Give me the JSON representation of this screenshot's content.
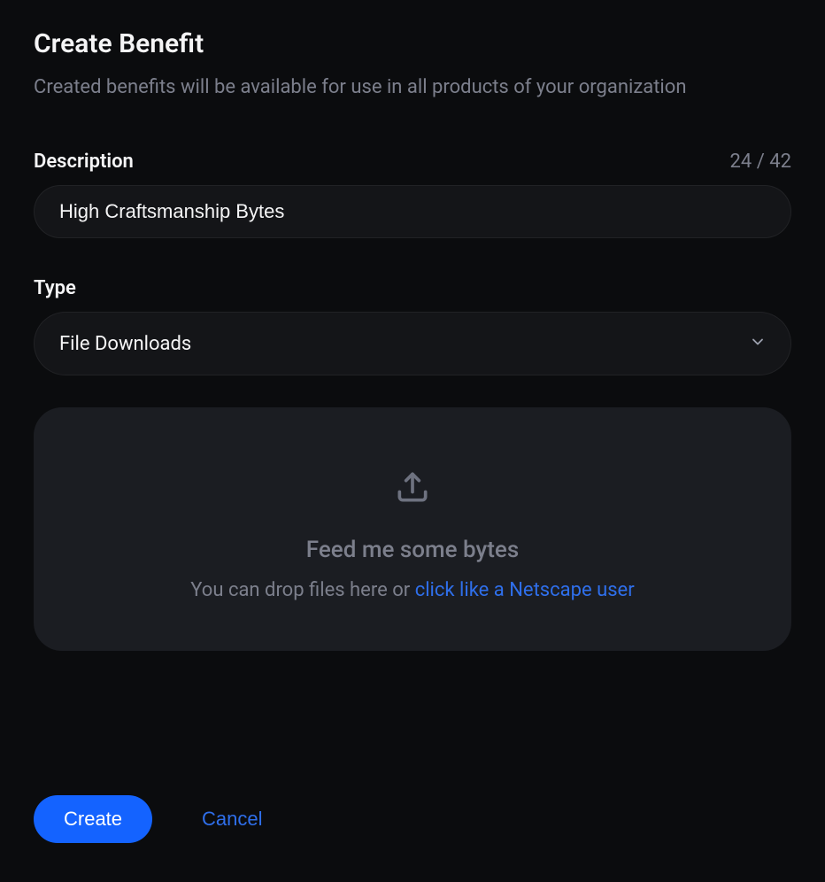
{
  "header": {
    "title": "Create Benefit",
    "subtitle": "Created benefits will be available for use in all products of your organization"
  },
  "form": {
    "description_label": "Description",
    "description_counter": "24 / 42",
    "description_value": "High Craftsmanship Bytes",
    "type_label": "Type",
    "type_value": "File Downloads"
  },
  "dropzone": {
    "title": "Feed me some bytes",
    "subtitle_prefix": "You can drop files here or ",
    "subtitle_link": "click like a Netscape user"
  },
  "actions": {
    "create": "Create",
    "cancel": "Cancel"
  }
}
